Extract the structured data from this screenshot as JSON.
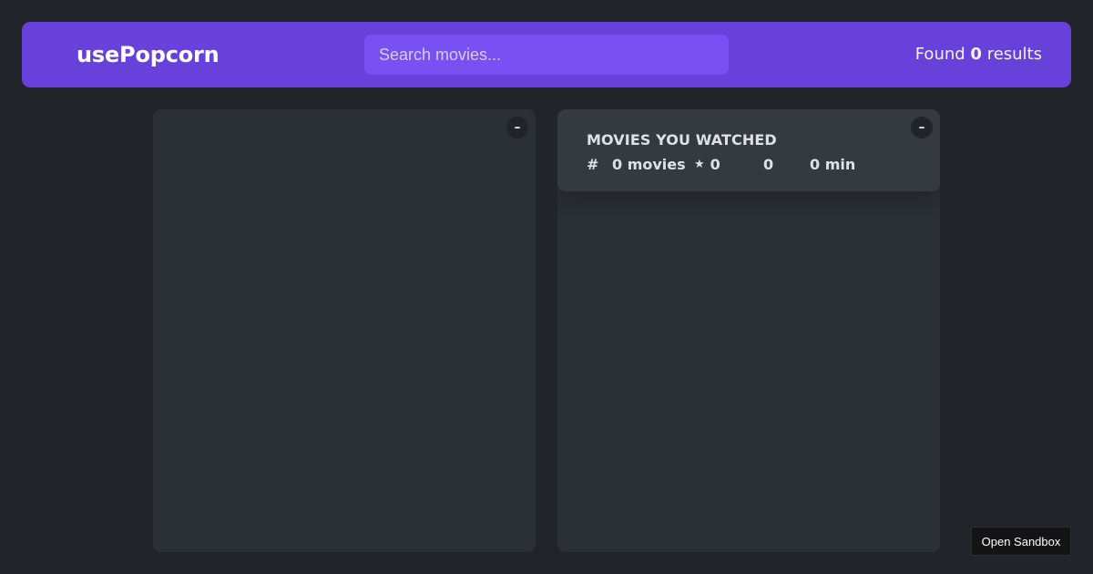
{
  "navbar": {
    "logo_text": "usePopcorn",
    "search_placeholder": "Search movies...",
    "search_value": "",
    "results_prefix": "Found",
    "results_count": "0",
    "results_suffix": "results"
  },
  "list_box": {
    "toggle_label": "–"
  },
  "watched_box": {
    "toggle_label": "–",
    "summary": {
      "title": "Movies you watched",
      "count_icon": "#",
      "count_text": "0 movies",
      "imdb_icon": "⭐",
      "imdb_text": "0",
      "user_icon": "🌟",
      "user_text": "0",
      "runtime_icon": "⏳",
      "runtime_text": "0 min"
    }
  },
  "sandbox": {
    "button_label": "Open Sandbox"
  },
  "colors": {
    "background": "#212529",
    "navbar": "#6741d9",
    "search": "#7950f2",
    "box": "#2b3035",
    "summary": "#343a40"
  }
}
